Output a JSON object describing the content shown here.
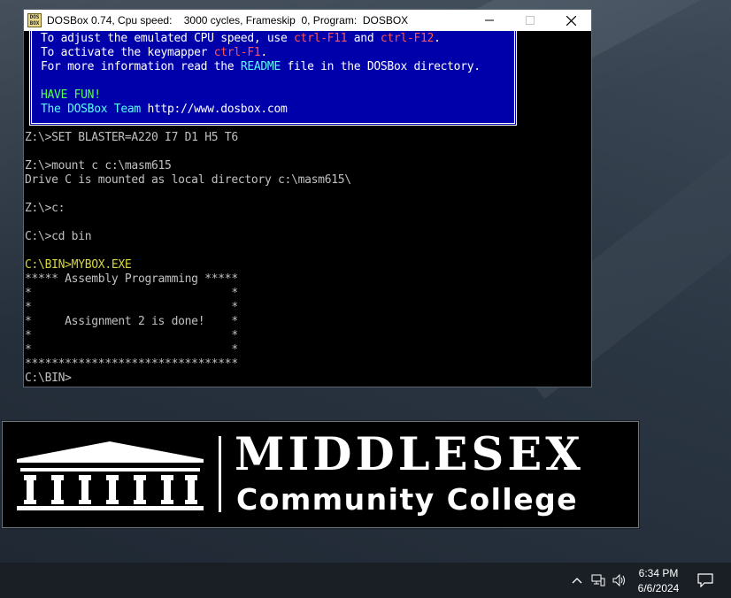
{
  "window": {
    "title": "DOSBox 0.74, Cpu speed:    3000 cycles, Frameskip  0, Program:  DOSBOX",
    "icon_text": "DOS BOX",
    "minimize_icon": "minimize-icon",
    "maximize_icon": "maximize-icon",
    "close_icon": "close-icon"
  },
  "welcome_box": {
    "line1": {
      "a": "To adjust the emulated CPU speed, use ",
      "b": "ctrl-F11",
      "c": " and ",
      "d": "ctrl-F12",
      "e": "."
    },
    "line2": {
      "a": "To activate the keymapper ",
      "b": "ctrl-F1",
      "c": "."
    },
    "line3": {
      "a": "For more information read the ",
      "b": "README",
      "c": " file in the DOSBox directory."
    },
    "line4": "HAVE FUN!",
    "line5": {
      "a": "The DOSBox Team ",
      "b": "http://www.dosbox.com"
    }
  },
  "console": {
    "lines": [
      "Z:\\>SET BLASTER=A220 I7 D1 H5 T6",
      "",
      "Z:\\>mount c c:\\masm615",
      "Drive C is mounted as local directory c:\\masm615\\",
      "",
      "Z:\\>c:",
      "",
      "C:\\>cd bin",
      "",
      "C:\\BIN>MYBOX.EXE",
      "***** Assembly Programming *****",
      "*                              *",
      "*                              *",
      "*     Assignment 2 is done!    *",
      "*                              *",
      "*                              *",
      "********************************",
      "C:\\BIN>"
    ]
  },
  "logo": {
    "line1": "MIDDLESEX",
    "line2": "Community College"
  },
  "taskbar": {
    "time": "6:34 PM",
    "date": "6/6/2024",
    "icons": [
      "chevron-up-icon",
      "network-icon",
      "volume-icon",
      "notification-icon"
    ]
  }
}
